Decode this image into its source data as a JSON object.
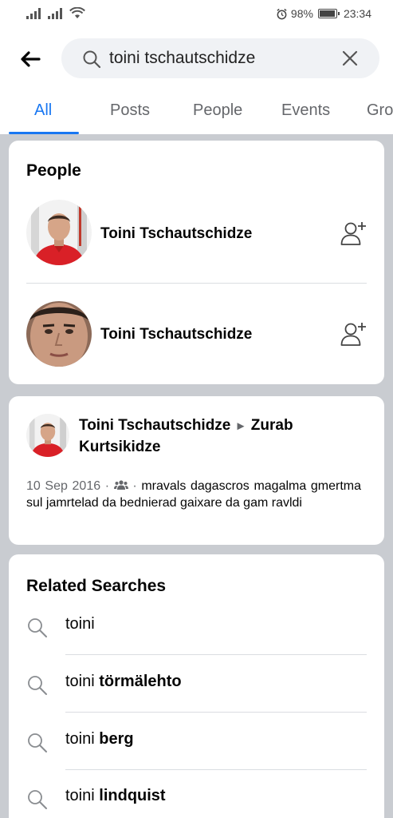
{
  "status_bar": {
    "battery": "98%",
    "time": "23:34",
    "battery_level": 0.98
  },
  "search": {
    "query": "toini tschautschidze"
  },
  "tabs": [
    {
      "label": "All",
      "active": true
    },
    {
      "label": "Posts"
    },
    {
      "label": "People"
    },
    {
      "label": "Events"
    },
    {
      "label": "Gro"
    }
  ],
  "people": {
    "title": "People",
    "items": [
      {
        "name": "Toini Tschautschidze",
        "icon": "add-friend-icon"
      },
      {
        "name": "Toini Tschautschidze",
        "icon": "add-friend-icon"
      }
    ]
  },
  "post": {
    "author": "Toini Tschautschidze",
    "arrow": "►",
    "target": "Zurab Kurtsikidze",
    "date": "10 Sep 2016",
    "sep": "·",
    "audience_icon": "friends-icon",
    "text": "mravals dagascros magalma gmertma sul jamrtelad da bednierad gaixare da gam ravldi"
  },
  "related": {
    "title": "Related Searches",
    "items": [
      {
        "prefix": "toini",
        "bold": ""
      },
      {
        "prefix": "toini",
        "bold": "törmälehto"
      },
      {
        "prefix": "toini",
        "bold": "berg"
      },
      {
        "prefix": "toini",
        "bold": "lindquist"
      }
    ]
  },
  "colors": {
    "accent": "#1877f2",
    "background": "#c9ccd1",
    "muted": "#65676b"
  }
}
